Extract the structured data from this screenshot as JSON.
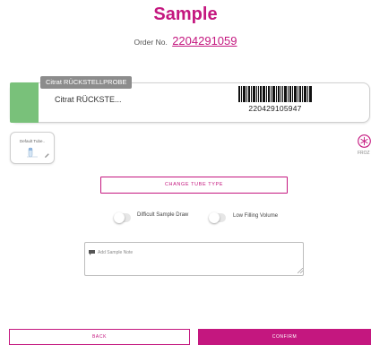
{
  "header": {
    "title": "Sample",
    "order_label": "Order No.",
    "order_number": "2204291059"
  },
  "tube": {
    "tag": "Citrat RÜCKSTELLPROBE",
    "name": "Citrat RÜCKSTE...",
    "barcode_number": "220429105947",
    "cap_color": "#79c17a"
  },
  "default_tube": {
    "label": "Default Tube..",
    "icon": "tube-icon"
  },
  "frozen": {
    "label": "FROZ",
    "icon": "snowflake-icon",
    "color": "#c4177f"
  },
  "change_tube_button": "CHANGE TUBE TYPE",
  "toggles": {
    "difficult_draw": {
      "label": "Difficult Sample Draw",
      "on": false
    },
    "low_filling": {
      "label": "Low Filling Volume",
      "on": false
    }
  },
  "note": {
    "placeholder": "Add Sample Note",
    "icon": "comment-icon"
  },
  "footer": {
    "back_label": "BACK",
    "confirm_label": "CONFIRM"
  },
  "colors": {
    "accent": "#c4177f"
  }
}
